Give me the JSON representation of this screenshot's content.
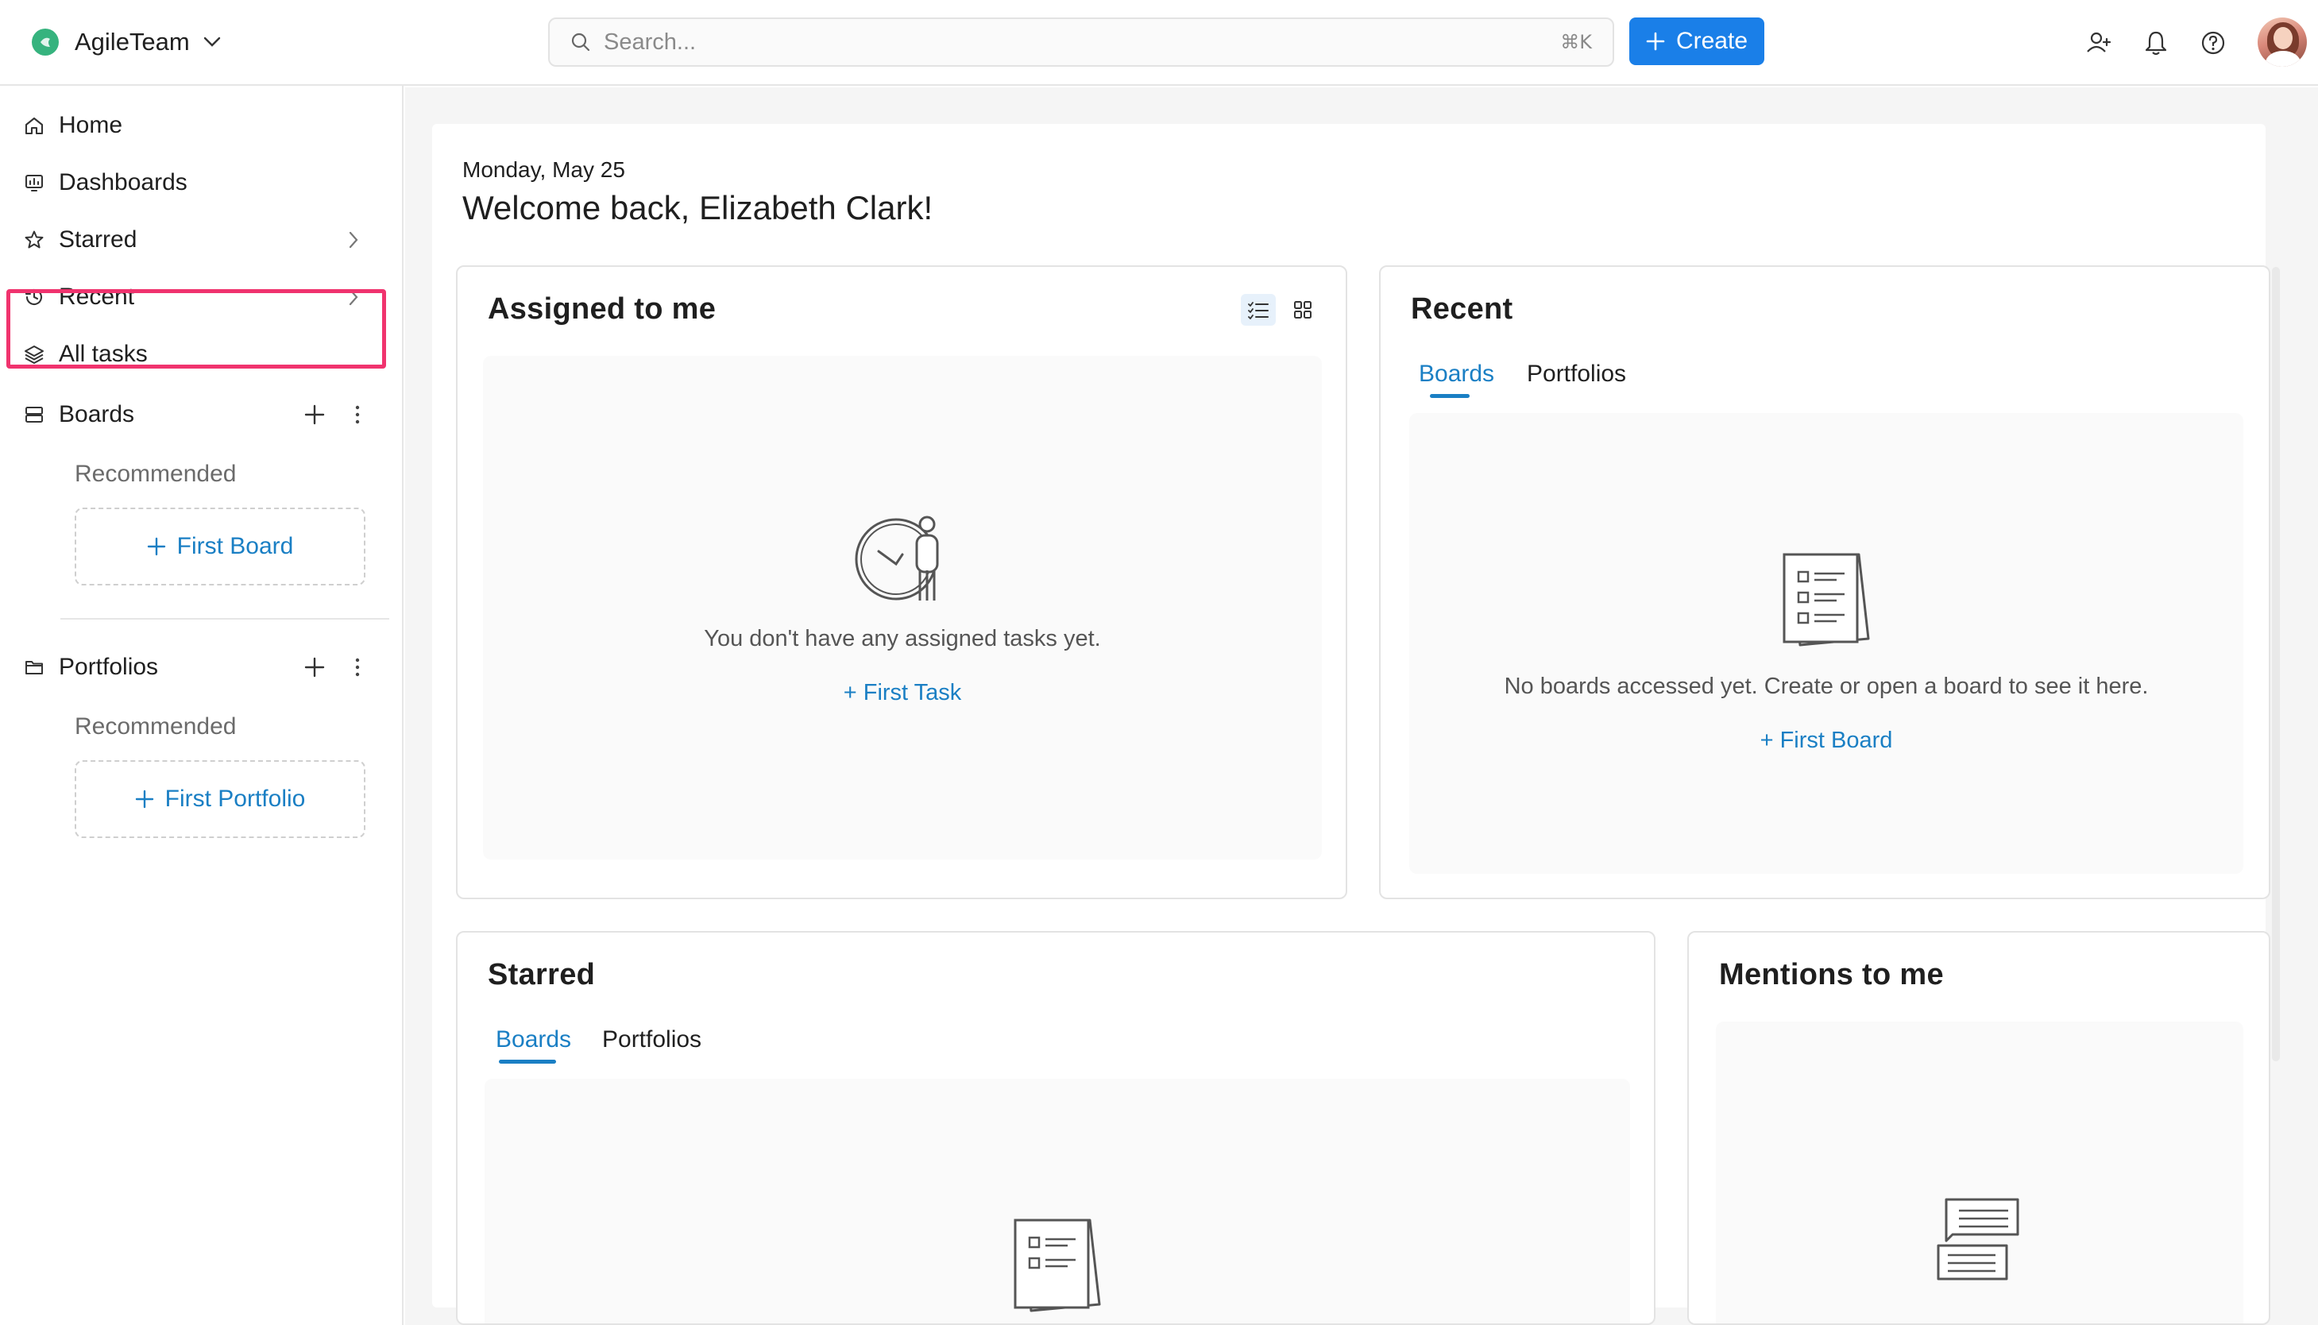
{
  "header": {
    "workspace_name": "AgileTeam",
    "search_placeholder": "Search...",
    "search_shortcut": "⌘K",
    "create_label": "Create",
    "brand_color": "#36b37e",
    "accent_color": "#1a7fe8"
  },
  "sidebar": {
    "home": "Home",
    "dashboards": "Dashboards",
    "starred": "Starred",
    "recent": "Recent",
    "all_tasks": "All tasks",
    "boards": "Boards",
    "boards_recommended": "Recommended",
    "first_board": "First Board",
    "portfolios": "Portfolios",
    "portfolios_recommended": "Recommended",
    "first_portfolio": "First Portfolio",
    "highlight_color": "#f0336e"
  },
  "main": {
    "date": "Monday, May 25",
    "welcome": "Welcome back, Elizabeth Clark!",
    "assigned": {
      "title": "Assigned to me",
      "empty_text": "You don't have any assigned tasks yet.",
      "action": "+ First Task"
    },
    "recent": {
      "title": "Recent",
      "tabs": [
        "Boards",
        "Portfolios"
      ],
      "active_tab": "Boards",
      "empty_text": "No boards accessed yet. Create or open a board to see it here.",
      "action": "+ First Board"
    },
    "starred": {
      "title": "Starred",
      "tabs": [
        "Boards",
        "Portfolios"
      ],
      "active_tab": "Boards"
    },
    "mentions": {
      "title": "Mentions to me"
    }
  }
}
